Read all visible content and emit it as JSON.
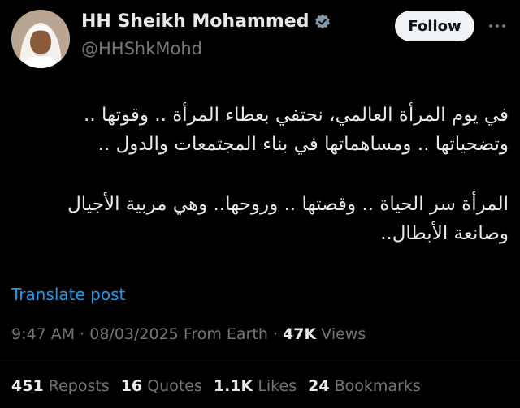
{
  "author": {
    "display_name": "HH Sheikh Mohammed",
    "handle": "@HHShkMohd",
    "verified_icon": "verified-badge-icon"
  },
  "actions": {
    "follow_label": "Follow",
    "more_icon": "more-horizontal-icon"
  },
  "post": {
    "lines": [
      "في يوم المرأة العالمي، نحتفي بعطاء المرأة .. وقوتها ..",
      "وتضحياتها .. ومساهماتها في بناء المجتمعات والدول ..",
      "المرأة سر الحياة .. وقصتها .. وروحها.. وهي مربية الأجيال",
      "وصانعة الأبطال.."
    ],
    "translate_label": "Translate post"
  },
  "meta": {
    "time": "9:47 AM",
    "date": "08/03/2025",
    "source": "From Earth",
    "views_count": "47K",
    "views_label": "Views"
  },
  "stats": {
    "reposts_count": "451",
    "reposts_label": "Reposts",
    "quotes_count": "16",
    "quotes_label": "Quotes",
    "likes_count": "1.1K",
    "likes_label": "Likes",
    "bookmarks_count": "24",
    "bookmarks_label": "Bookmarks"
  },
  "colors": {
    "background": "#000000",
    "text": "#e7e9ea",
    "muted": "#71767b",
    "link": "#1d9bf0",
    "verified": "#829aab",
    "follow_bg": "#eff3f4"
  }
}
